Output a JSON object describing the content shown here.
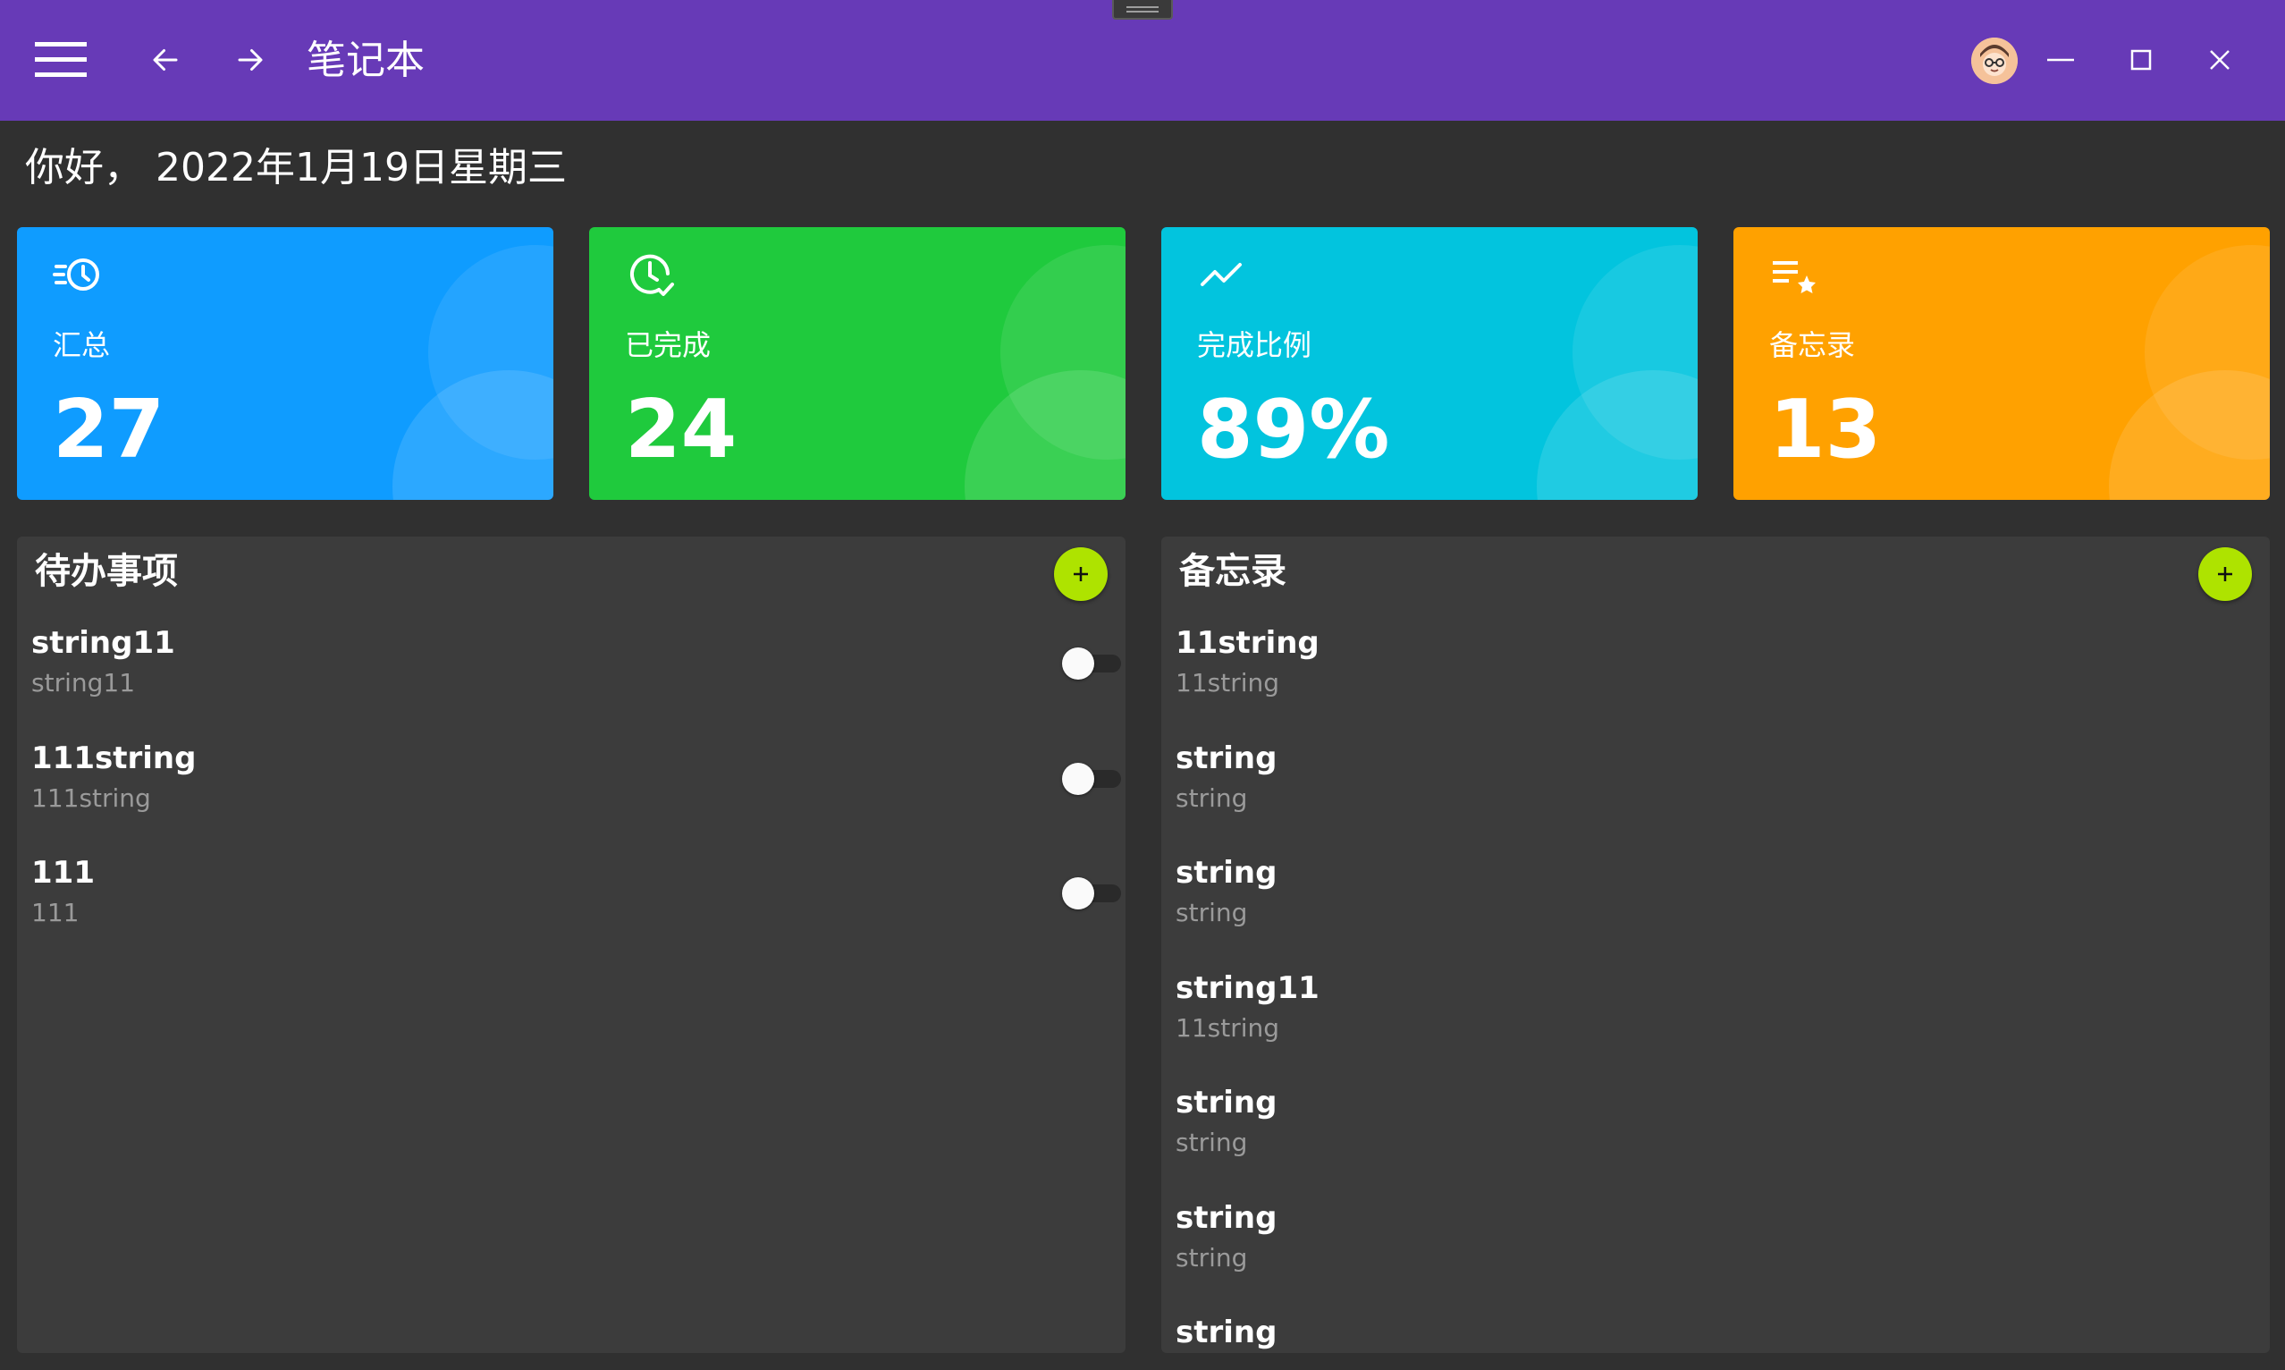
{
  "window": {
    "title": "笔记本",
    "menu_icon": "hamburger-menu-icon",
    "back_icon": "arrow-left-icon",
    "forward_icon": "arrow-right-icon",
    "avatar_icon": "user-avatar",
    "minimize_icon": "minimize-icon",
    "maximize_icon": "maximize-icon",
    "close_icon": "close-icon",
    "bar_color": "#673ab7"
  },
  "greeting": "你好， 2022年1月19日星期三",
  "stats": [
    {
      "icon": "history-icon",
      "label": "汇总",
      "value": "27",
      "color": "#0f9cff"
    },
    {
      "icon": "clock-check-icon",
      "label": "已完成",
      "value": "24",
      "color": "#1fca3d"
    },
    {
      "icon": "trending-up-icon",
      "label": "完成比例",
      "value": "89%",
      "color": "#02c4de"
    },
    {
      "icon": "playlist-star-icon",
      "label": "备忘录",
      "value": "13",
      "color": "#ffa100"
    }
  ],
  "todo": {
    "title": "待办事项",
    "add_icon": "plus-icon",
    "items": [
      {
        "title": "string11",
        "content": "string11",
        "done": false
      },
      {
        "title": "111string",
        "content": "111string",
        "done": false
      },
      {
        "title": "111",
        "content": "111",
        "done": false
      }
    ]
  },
  "memo": {
    "title": "备忘录",
    "add_icon": "plus-icon",
    "items": [
      {
        "title": "11string",
        "content": "11string"
      },
      {
        "title": "string",
        "content": "string"
      },
      {
        "title": "string",
        "content": "string"
      },
      {
        "title": "string11",
        "content": "11string"
      },
      {
        "title": "string",
        "content": "string"
      },
      {
        "title": "string",
        "content": "string"
      },
      {
        "title": "string",
        "content": ""
      }
    ]
  },
  "accent_color": "#aee300"
}
